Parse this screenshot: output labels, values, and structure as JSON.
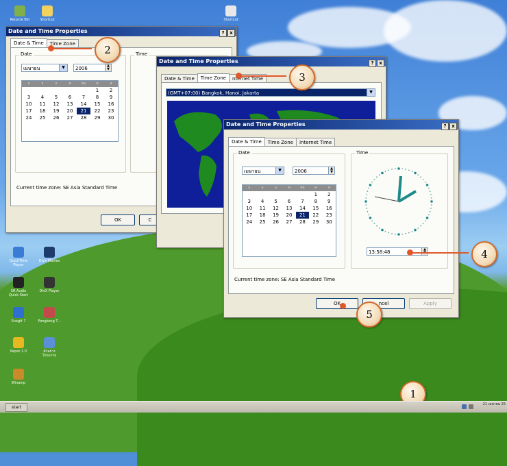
{
  "window_title": "Date and Time Properties",
  "titlebar_buttons": [
    "?",
    "x"
  ],
  "tabs": [
    "Date & Time",
    "Time Zone",
    "Internet Time"
  ],
  "tabs_obscured": {
    "date_time": "Date & Time",
    "time_zone": "Time Zone",
    "internet_time": "nternet Time"
  },
  "date_group_label": "Date",
  "time_group_label": "Time",
  "month_value": "เมษายน",
  "year_value": "2006",
  "weekday_headers": [
    "อ",
    "จ",
    "อ",
    "พ",
    "พฤ",
    "ศ",
    "ส"
  ],
  "calendar_days": [
    "",
    "",
    "",
    "",
    "",
    "1",
    "2",
    "3",
    "4",
    "5",
    "6",
    "7",
    "8",
    "9",
    "10",
    "11",
    "12",
    "13",
    "14",
    "15",
    "16",
    "17",
    "18",
    "19",
    "20",
    "21",
    "22",
    "23",
    "24",
    "25",
    "26",
    "27",
    "28",
    "29",
    "30"
  ],
  "selected_day": "21",
  "time_value": "13:58:48",
  "timezone_status": "Current time zone:  SE Asia Standard Time",
  "timezone_value": "(GMT+07:00) Bangkok, Hanoi, Jakarta",
  "buttons": {
    "ok": "OK",
    "cancel": "ncel",
    "apply": "Apply",
    "cancel_back": "C"
  },
  "callouts": [
    "1",
    "2",
    "3",
    "4",
    "5"
  ],
  "taskbar": {
    "start": "start",
    "clock": "21 เมษายน 25"
  },
  "desktop_icons": [
    "Recycle Bin",
    "Shortcut",
    "Shortcut",
    "QuickTime Player",
    "DivX Movies",
    "SR Audio Quick Start",
    "DivX Player",
    "SnagIt 7",
    "Pongkong T...",
    "Kepar 1.0",
    "ตัวอย่างโปรแกรม",
    "Winamp"
  ],
  "colors": {
    "accent": "#0a246a",
    "callout_line": "#e0582a",
    "callout_ring": "#d06a2a"
  }
}
